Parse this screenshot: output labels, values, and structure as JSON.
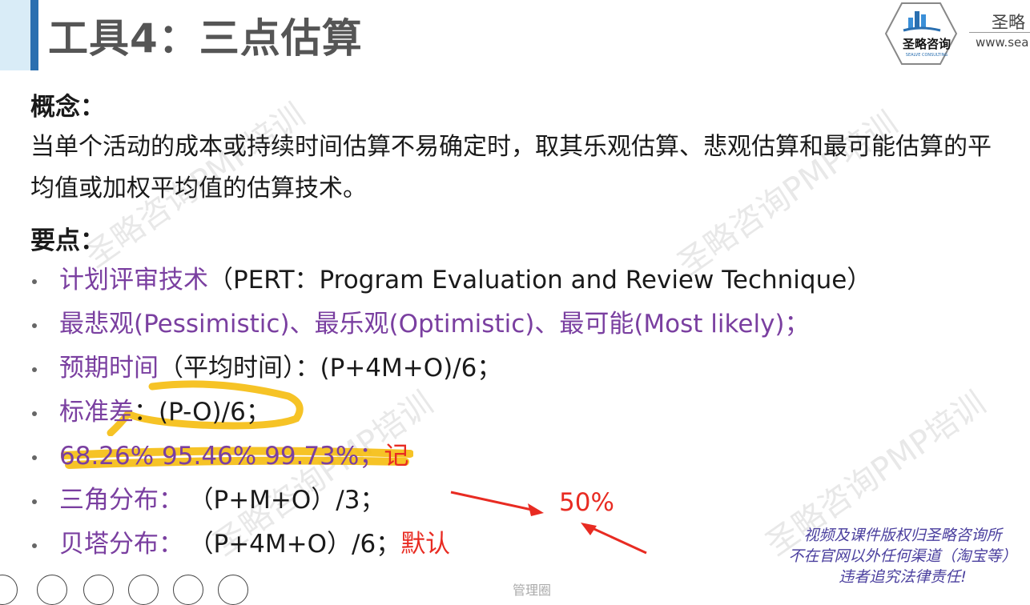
{
  "header": {
    "title": "工具4：三点估算",
    "logo_text": "圣略咨询",
    "logo_subtext": "SEALVE CONSULTING",
    "brand_name": "圣略",
    "brand_url": "www.sea"
  },
  "concept": {
    "heading": "概念：",
    "text": "当单个活动的成本或持续时间估算不易确定时，取其乐观估算、悲观估算和最可能估算的平均值或加权平均值的估算技术。"
  },
  "key_points": {
    "heading": "要点：",
    "items": [
      {
        "label": "计划评审技术",
        "rest": "（PERT：Program Evaluation and Review Technique）",
        "note": ""
      },
      {
        "label": "最悲观(Pessimistic)、最乐观(Optimistic)、最可能(Most  likely)；",
        "rest": "",
        "note": ""
      },
      {
        "label": "预期时间",
        "rest": "（平均时间）：(P+4M+O)/6；",
        "note": ""
      },
      {
        "label": "标准差",
        "rest": "：(P-O)/6；",
        "note": ""
      },
      {
        "label": "68.26% 95.46% 99.73%；",
        "rest": "",
        "note": "记"
      },
      {
        "label": "三角分布：",
        "rest": "（P+M+O）/3；",
        "note": ""
      },
      {
        "label": "贝塔分布：",
        "rest": "（P+4M+O）/6；",
        "note": "默认"
      }
    ]
  },
  "annotation": {
    "percent_label": "50%"
  },
  "watermark_text": "圣略咨询PMP培训",
  "copyright": {
    "line1": "视频及课件版权归圣略咨询所",
    "line2": "不在官网以外任何渠道（淘宝等）",
    "line3": "违者追究法律责任!"
  },
  "footer_faint": "管理圈",
  "colors": {
    "accent_blue": "#2a6fb0",
    "purple": "#7a3fa0",
    "red": "#e82b22",
    "highlight": "#f5b800"
  }
}
